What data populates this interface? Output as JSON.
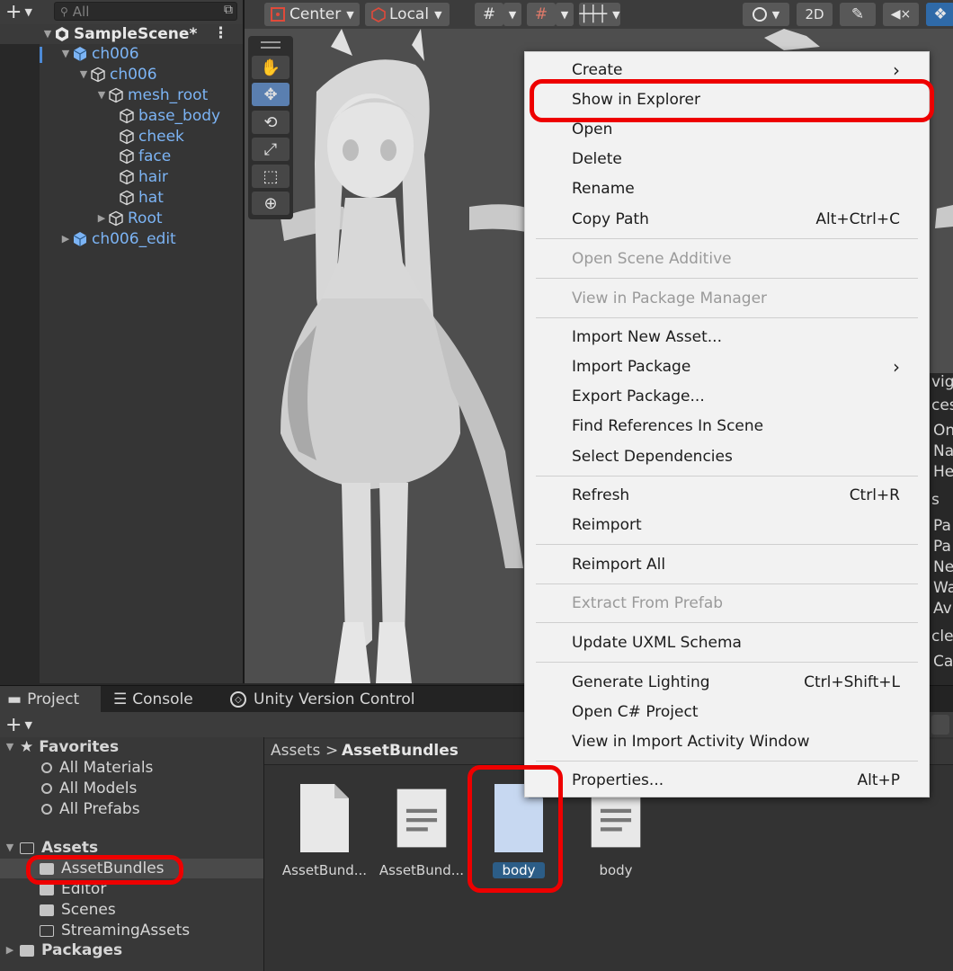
{
  "hierarchy": {
    "search_placeholder": "All",
    "scene_name": "SampleScene*",
    "items": [
      {
        "label": "ch006"
      },
      {
        "label": "ch006"
      },
      {
        "label": "mesh_root"
      },
      {
        "label": "base_body"
      },
      {
        "label": "cheek"
      },
      {
        "label": "face"
      },
      {
        "label": "hair"
      },
      {
        "label": "hat"
      },
      {
        "label": "Root"
      },
      {
        "label": "ch006_edit"
      }
    ]
  },
  "scene_toolbar": {
    "pivot": "Center",
    "space": "Local",
    "mode_2d": "2D"
  },
  "context_menu": {
    "items": [
      {
        "label": "Create",
        "shortcut": ""
      },
      {
        "label": "Show in Explorer",
        "shortcut": ""
      },
      {
        "label": "Open",
        "shortcut": ""
      },
      {
        "label": "Delete",
        "shortcut": ""
      },
      {
        "label": "Rename",
        "shortcut": ""
      },
      {
        "label": "Copy Path",
        "shortcut": "Alt+Ctrl+C"
      },
      {
        "label": "Open Scene Additive",
        "shortcut": ""
      },
      {
        "label": "View in Package Manager",
        "shortcut": ""
      },
      {
        "label": "Import New Asset...",
        "shortcut": ""
      },
      {
        "label": "Import Package",
        "shortcut": ""
      },
      {
        "label": "Export Package...",
        "shortcut": ""
      },
      {
        "label": "Find References In Scene",
        "shortcut": ""
      },
      {
        "label": "Select Dependencies",
        "shortcut": ""
      },
      {
        "label": "Refresh",
        "shortcut": "Ctrl+R"
      },
      {
        "label": "Reimport",
        "shortcut": ""
      },
      {
        "label": "Reimport All",
        "shortcut": ""
      },
      {
        "label": "Extract From Prefab",
        "shortcut": ""
      },
      {
        "label": "Update UXML Schema",
        "shortcut": ""
      },
      {
        "label": "Generate Lighting",
        "shortcut": "Ctrl+Shift+L"
      },
      {
        "label": "Open C# Project",
        "shortcut": ""
      },
      {
        "label": "View in Import Activity Window",
        "shortcut": ""
      },
      {
        "label": "Properties...",
        "shortcut": "Alt+P"
      }
    ],
    "submenu_glyph": "›"
  },
  "inspector_fragments": [
    "vig",
    "ces",
    "On",
    "Na",
    "He",
    "s",
    "Pa",
    "Pa",
    "Ne",
    "Wa",
    "Av",
    "cle",
    "Ca"
  ],
  "project": {
    "tabs": [
      "Project",
      "Console",
      "Unity Version Control"
    ],
    "tree": {
      "favorites_label": "Favorites",
      "favorites": [
        "All Materials",
        "All Models",
        "All Prefabs"
      ],
      "assets_label": "Assets",
      "assets": [
        "AssetBundles",
        "Editor",
        "Scenes",
        "StreamingAssets"
      ],
      "packages_label": "Packages"
    },
    "breadcrumb": {
      "root": "Assets",
      "separator": ">",
      "current": "AssetBundles"
    },
    "assets": [
      {
        "label": "AssetBund..."
      },
      {
        "label": "AssetBund..."
      },
      {
        "label": "body"
      },
      {
        "label": "body"
      }
    ]
  },
  "colors": {
    "highlight": "#ee0000",
    "hierarchy_link": "#7cb4f5",
    "selection": "#2c5d87",
    "menu_bg": "#f2f2f2"
  }
}
